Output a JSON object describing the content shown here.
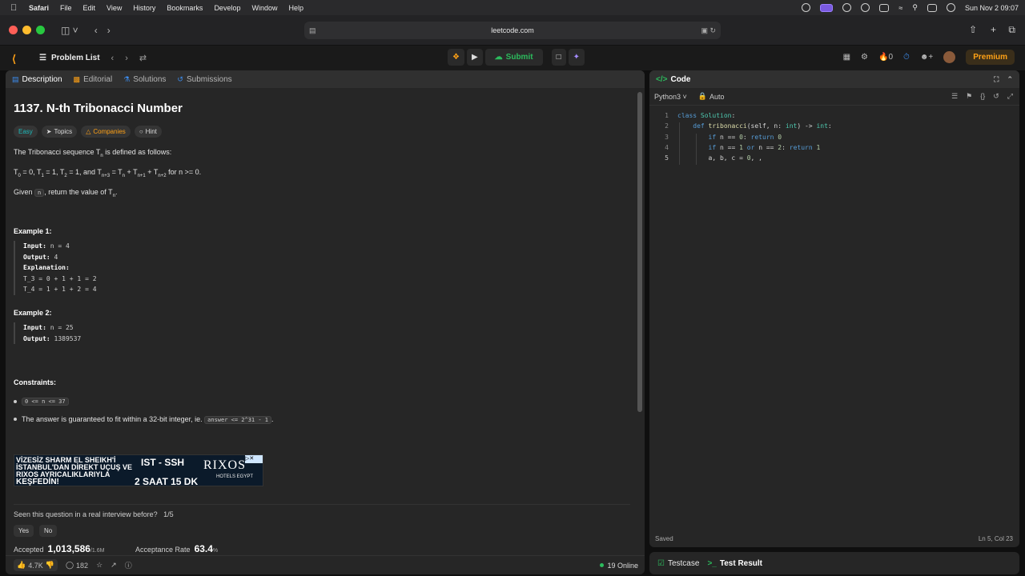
{
  "menubar": {
    "items": [
      "Safari",
      "File",
      "Edit",
      "View",
      "History",
      "Bookmarks",
      "Develop",
      "Window",
      "Help"
    ],
    "clock": "Sun Nov 2  09:07"
  },
  "browser": {
    "url": "leetcode.com"
  },
  "nav": {
    "problem_list": "Problem List",
    "submit": "Submit",
    "streak": "0",
    "premium": "Premium"
  },
  "left_tabs": [
    "Description",
    "Editorial",
    "Solutions",
    "Submissions"
  ],
  "problem": {
    "title": "1137. N-th Tribonacci Number",
    "tags": [
      "Easy",
      "Topics",
      "Companies",
      "Hint"
    ],
    "intro": "The Tribonacci sequence T",
    "intro_sub": "n",
    "intro_end": " is defined as follows:",
    "given_pre": "Given ",
    "given_code": "n",
    "given_mid": ", return the value of T",
    "given_sub": "n",
    "given_end": ".",
    "example1_label": "Example 1:",
    "example2_label": "Example 2:",
    "ex1_input_l": "Input:",
    "ex1_input_v": " n = 4",
    "ex1_output_l": "Output:",
    "ex1_output_v": " 4",
    "ex1_expl_l": "Explanation:",
    "ex1_l1": "T_3 = 0 + 1 + 1 = 2",
    "ex1_l2": "T_4 = 1 + 1 + 2 = 4",
    "ex2_input_l": "Input:",
    "ex2_input_v": " n = 25",
    "ex2_output_l": "Output:",
    "ex2_output_v": " 1389537",
    "constraints_label": "Constraints:",
    "c1": "0 <= n <= 37",
    "c2_text": "The answer is guaranteed to fit within a 32-bit integer, ie. ",
    "c2_code": "answer <= 2^31 - 1",
    "c2_end": "."
  },
  "ad": {
    "line1": "VİZESİZ SHARM EL SHEIKH'İ İSTANBUL'DAN DİREKT UÇUŞ VE RIXOS AYRICALIKLARIYLA",
    "cta": "KEŞFEDİN!",
    "route": "IST - SSH",
    "time": "2 SAAT 15 DK",
    "brand": "RIXOS",
    "brand_sub": "HOTELS EGYPT"
  },
  "interview": {
    "question": "Seen this question in a real interview before?",
    "count": "1/5",
    "yes": "Yes",
    "no": "No"
  },
  "stats": {
    "accepted_label": "Accepted",
    "accepted": "1,013,586",
    "accepted_total": "/1.6M",
    "rate_label": "Acceptance Rate",
    "rate": "63.4",
    "rate_unit": "%"
  },
  "footer": {
    "likes": "4.7K",
    "comments": "182",
    "online": "19 Online"
  },
  "code_panel": {
    "title": "Code",
    "language": "Python3",
    "auto": "Auto",
    "lines": [
      "class Solution:",
      "    def tribonacci(self, n: int) -> int:",
      "        if n == 0: return 0",
      "        if n == 1 or n == 2: return 1",
      "        a, b, c = 0, ,"
    ],
    "status": "Saved",
    "cursor": "Ln 5, Col 23"
  },
  "bottom_tabs": {
    "testcase": "Testcase",
    "result": "Test Result"
  }
}
